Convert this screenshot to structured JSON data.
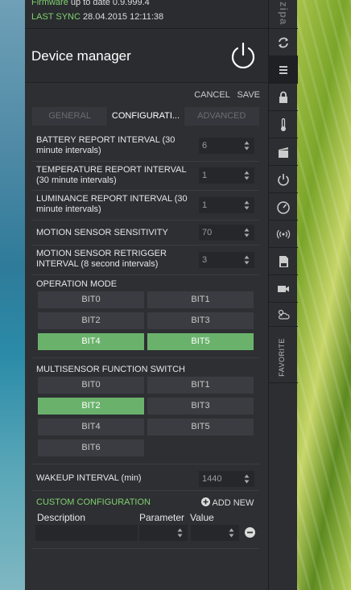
{
  "status": {
    "firmware_label": "Firmware",
    "firmware_text": "up to date 0.9.999.4",
    "sync_label": "LAST SYNC",
    "sync_text": "28.04.2015 12:11:38"
  },
  "header": {
    "title": "Device manager"
  },
  "actions": {
    "cancel": "CANCEL",
    "save": "SAVE"
  },
  "tabs": [
    {
      "label": "GENERAL",
      "active": false
    },
    {
      "label": "CONFIGURATI...",
      "active": true
    },
    {
      "label": "ADVANCED",
      "active": false
    }
  ],
  "settings": [
    {
      "label": "BATTERY REPORT INTERVAL (30 minute intervals)",
      "value": "6"
    },
    {
      "label": "TEMPERATURE REPORT INTERVAL (30 minute intervals)",
      "value": "1"
    },
    {
      "label": "LUMINANCE REPORT INTERVAL (30 minute intervals)",
      "value": "1"
    },
    {
      "label": "MOTION SENSOR SENSITIVITY",
      "value": "70"
    },
    {
      "label": "MOTION SENSOR RETRIGGER INTERVAL (8 second intervals)",
      "value": "3"
    }
  ],
  "operation_mode": {
    "label": "OPERATION MODE",
    "bits": [
      {
        "label": "BIT0",
        "on": false
      },
      {
        "label": "BIT1",
        "on": false
      },
      {
        "label": "BIT2",
        "on": false
      },
      {
        "label": "BIT3",
        "on": false
      },
      {
        "label": "BIT4",
        "on": true
      },
      {
        "label": "BIT5",
        "on": true
      }
    ]
  },
  "function_switch": {
    "label": "MULTISENSOR FUNCTION SWITCH",
    "bits": [
      {
        "label": "BIT0",
        "on": false
      },
      {
        "label": "BIT1",
        "on": false
      },
      {
        "label": "BIT2",
        "on": true
      },
      {
        "label": "BIT3",
        "on": false
      },
      {
        "label": "BIT4",
        "on": false
      },
      {
        "label": "BIT5",
        "on": false
      },
      {
        "label": "BIT6",
        "on": false
      }
    ]
  },
  "wakeup": {
    "label": "WAKEUP INTERVAL (min)",
    "value": "1440"
  },
  "custom": {
    "title": "CUSTOM CONFIGURATION",
    "add_new": "ADD NEW",
    "col_description": "Description",
    "col_parameter": "Parameter",
    "col_value": "Value"
  },
  "sidebar": {
    "brand": "zipa",
    "favorite": "FAVORITE",
    "icons": [
      "sync-icon",
      "menu-icon",
      "lock-icon",
      "thermometer-icon",
      "clapperboard-icon",
      "power-icon",
      "gauge-icon",
      "signal-icon",
      "sd-card-icon",
      "camera-icon",
      "weather-icon"
    ]
  },
  "colors": {
    "accent_green": "#6ab26c",
    "text_green": "#7ed26e",
    "panel": "#2e2f33"
  }
}
